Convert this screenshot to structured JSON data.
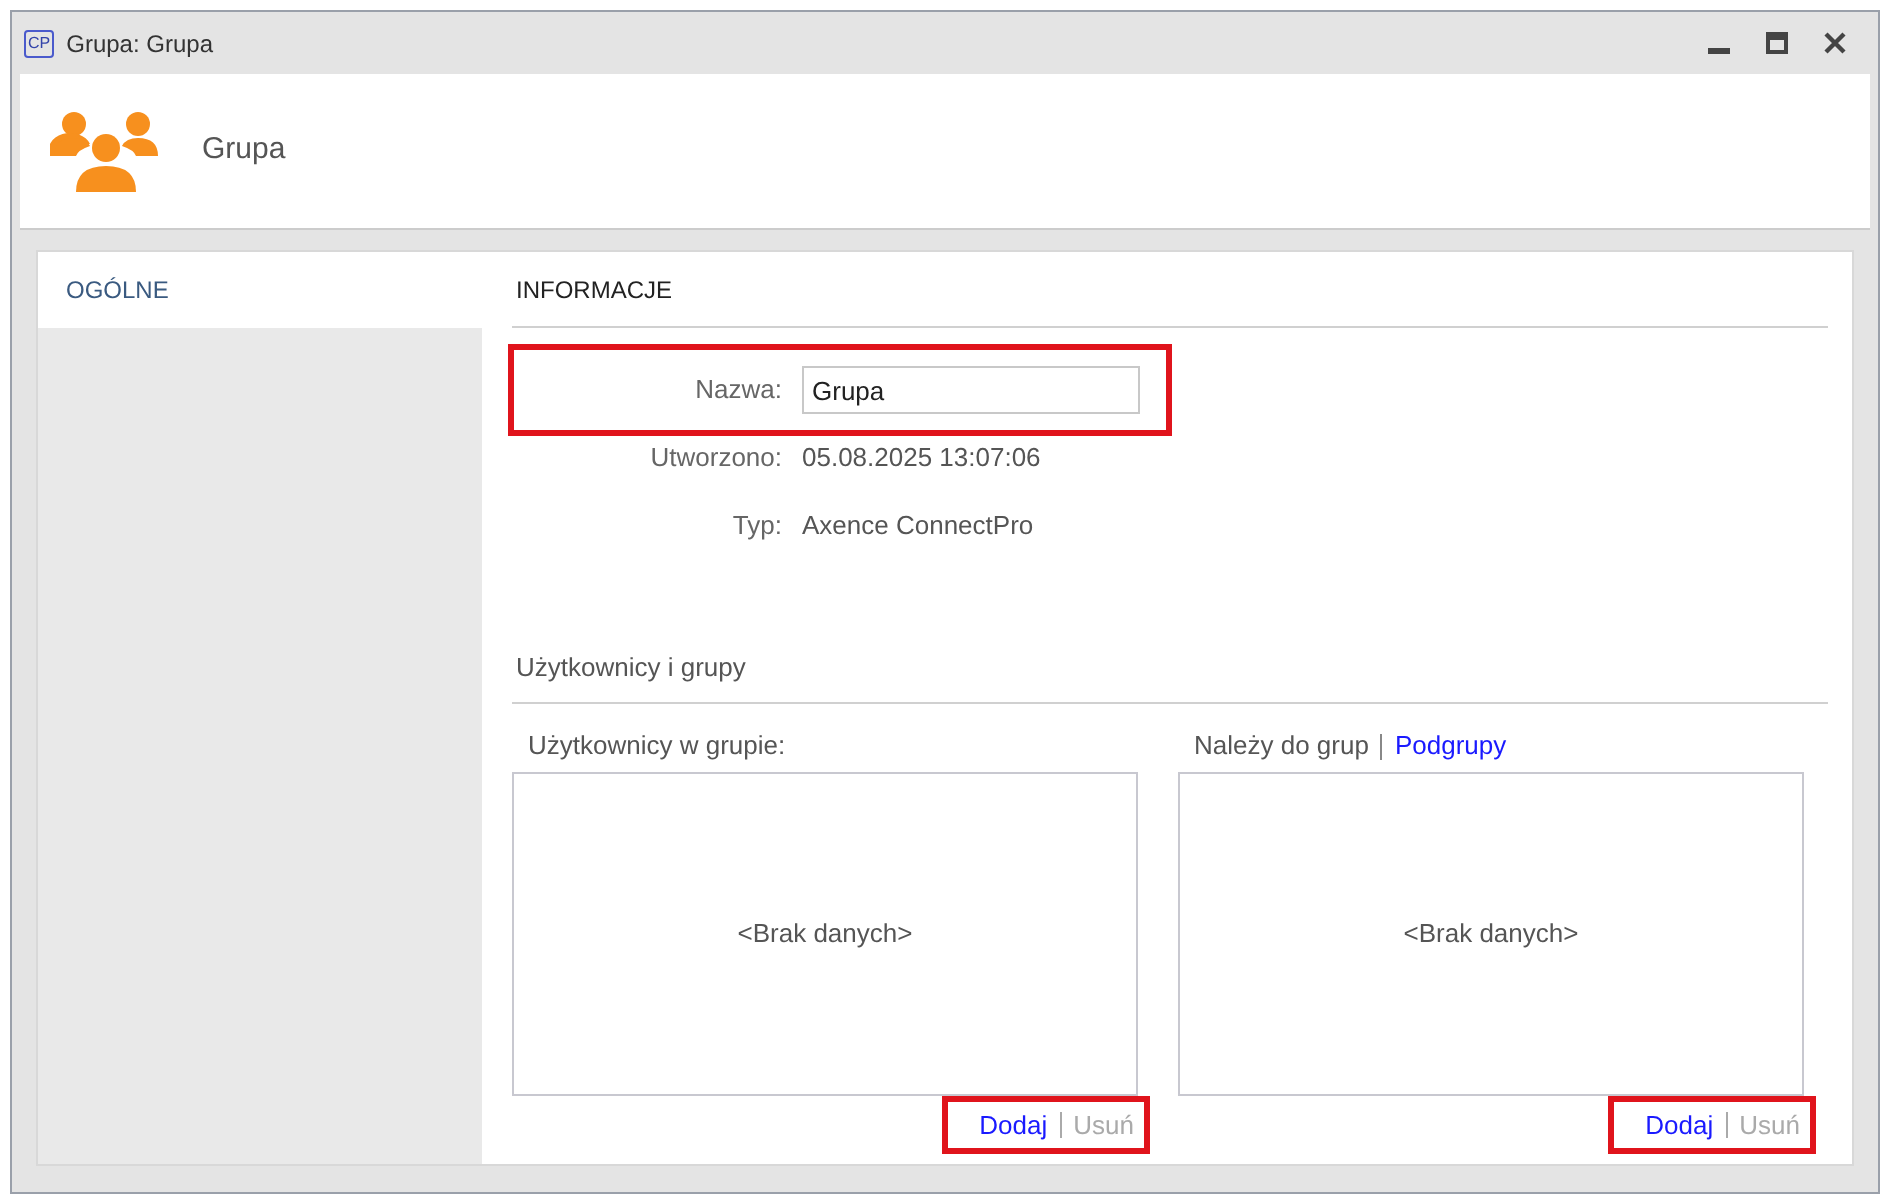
{
  "window": {
    "app_badge": "CP",
    "title": "Grupa: Grupa"
  },
  "header": {
    "title": "Grupa"
  },
  "sidebar": {
    "items": [
      {
        "label": "OGÓLNE",
        "selected": true
      }
    ]
  },
  "info": {
    "heading": "INFORMACJE",
    "fields": [
      {
        "kind": "input",
        "label": "Nazwa:",
        "value": "Grupa",
        "highlighted": true
      },
      {
        "kind": "text",
        "label": "Utworzono:",
        "value": "05.08.2025 13:07:06",
        "highlighted": false
      },
      {
        "kind": "text",
        "label": "Typ:",
        "value": "Axence ConnectPro",
        "highlighted": false
      }
    ]
  },
  "members": {
    "heading": "Użytkownicy i grupy",
    "lists": [
      {
        "tabs": [
          {
            "label": "Użytkownicy w grupie:",
            "selected": true
          }
        ],
        "empty_text": "<Brak danych>",
        "actions_highlighted": true,
        "actions": [
          {
            "label": "Dodaj",
            "disabled": false
          },
          {
            "label": "Usuń",
            "disabled": true
          }
        ]
      },
      {
        "tabs": [
          {
            "label": "Należy do grup",
            "selected": true
          },
          {
            "label": "Podgrupy",
            "selected": false
          }
        ],
        "empty_text": "<Brak danych>",
        "actions_highlighted": true,
        "actions": [
          {
            "label": "Dodaj",
            "disabled": false
          },
          {
            "label": "Usuń",
            "disabled": true
          }
        ]
      }
    ]
  }
}
